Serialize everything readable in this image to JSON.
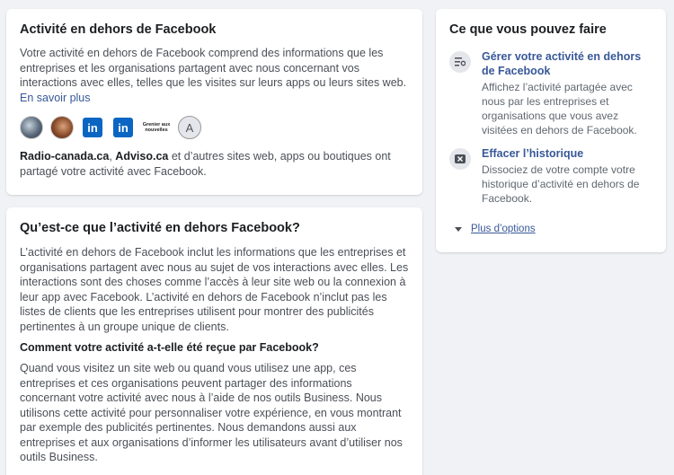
{
  "offsite": {
    "title": "Activité en dehors de Facebook",
    "intro": "Votre activité en dehors de Facebook comprend des informations que les entreprises et les organisations partagent avec nous concernant vos interactions avec elles, telles que les visites sur leurs apps ou leurs sites web.",
    "learn_more": "En savoir plus",
    "logos": [
      {
        "name": "site-photo-1",
        "text": ""
      },
      {
        "name": "site-photo-2",
        "text": ""
      },
      {
        "name": "linkedin-1",
        "text": "in"
      },
      {
        "name": "linkedin-2",
        "text": "in"
      },
      {
        "name": "grenier",
        "text": "Grenier aux nouvelles"
      },
      {
        "name": "badge",
        "text": "A"
      }
    ],
    "site1": "Radio-canada.ca",
    "sep": ", ",
    "site2": "Adviso.ca",
    "sites_rest": " et d’autres sites web, apps ou boutiques ont partagé votre activité avec Facebook."
  },
  "what": {
    "title": "Qu’est-ce que l’activité en dehors Facebook?",
    "para1": "L’activité en dehors de Facebook inclut les informations que les entreprises et organisations partagent avec nous au sujet de vos interactions avec elles. Les interactions sont des choses comme l’accès à leur site web ou la connexion à leur app avec Facebook. L’activité en dehors de Facebook n’inclut pas les listes de clients que les entreprises utilisent pour montrer des publicités pertinentes à un groupe unique de clients.",
    "subheading": "Comment votre activité a-t-elle été reçue par Facebook?",
    "para2": "Quand vous visitez un site web ou quand vous utilisez une app, ces entreprises et ces organisations peuvent partager des informations concernant votre activité avec nous à l’aide de nos outils Business. Nous utilisons cette activité pour personnaliser votre expérience, en vous montrant par exemple des publicités pertinentes. Nous demandons aussi aux entreprises et aux organisations d’informer les utilisateurs avant d’utiliser nos outils Business."
  },
  "actions": {
    "title": "Ce que vous pouvez faire",
    "items": [
      {
        "icon": "manage-list-icon",
        "label": "Gérer votre activité en dehors de Facebook",
        "desc": "Affichez l’activité partagée avec nous par les entreprises et organisations que vous avez visitées en dehors de Facebook."
      },
      {
        "icon": "clear-x-icon",
        "label": "Effacer l’historique",
        "desc": "Dissociez de votre compte votre historique d’activité en dehors de Facebook."
      }
    ],
    "more": "Plus d’options"
  },
  "colors": {
    "link": "#385898",
    "background": "#f0f2f5",
    "linkedin": "#0a66c2"
  }
}
